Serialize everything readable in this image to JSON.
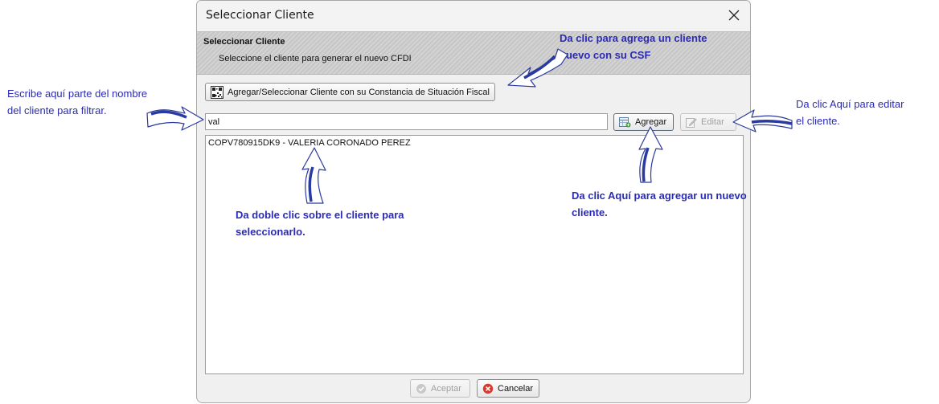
{
  "dialog": {
    "title": "Seleccionar Cliente",
    "header_title": "Seleccionar Cliente",
    "header_subtitle": "Seleccione el cliente para generar el nuevo CFDI",
    "csf_button_label": "Agregar/Seleccionar Cliente con su Constancia de Situación Fiscal",
    "search_value": "val",
    "add_button_label": "Agregar",
    "edit_button_label": "Editar",
    "clients": [
      "COPV780915DK9 - VALERIA CORONADO PEREZ"
    ],
    "accept_button_label": "Aceptar",
    "cancel_button_label": "Cancelar"
  },
  "annotations": {
    "search_hint": [
      "Escribe aquí parte del nombre",
      "del cliente para filtrar."
    ],
    "csf_hint": [
      "Da clic para agrega un cliente",
      "nuevo con su CSF"
    ],
    "edit_hint": [
      "Da clic Aquí para editar",
      "el cliente."
    ],
    "add_hint": [
      "Da clic Aquí para agregar un nuevo",
      "cliente."
    ],
    "select_hint": [
      "Da doble clic sobre el cliente para",
      "seleccionarlo."
    ]
  },
  "colors": {
    "annotation_text": "#2b2bb5",
    "arrow_fill": "#ffffff",
    "arrow_stroke": "#2b3a9e"
  },
  "icons": [
    "close-icon",
    "csf-qr-icon",
    "add-client-icon",
    "edit-icon",
    "accept-check-icon",
    "cancel-x-icon",
    "arrow-callout-icon"
  ]
}
